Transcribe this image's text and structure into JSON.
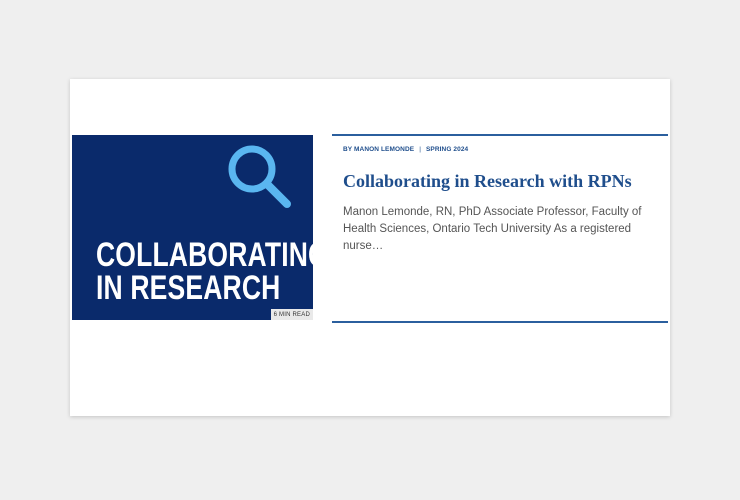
{
  "article": {
    "image": {
      "headline_line1": "COLLABORATING",
      "headline_line2": "IN RESEARCH",
      "read_time": "6 MIN READ",
      "icon": "magnifying-glass-icon",
      "colors": {
        "background": "#0a2a6b",
        "icon": "#5ab6f0",
        "text": "#ffffff"
      }
    },
    "byline": "BY MANON LEMONDE",
    "separator": "|",
    "issue": "SPRING 2024",
    "title": "Collaborating in Research with RPNs",
    "excerpt": "Manon Lemonde, RN, PhD Associate Professor, Faculty of Health Sciences, Ontario Tech University As a registered nurse…",
    "accent_color": "#1f4e8c"
  }
}
